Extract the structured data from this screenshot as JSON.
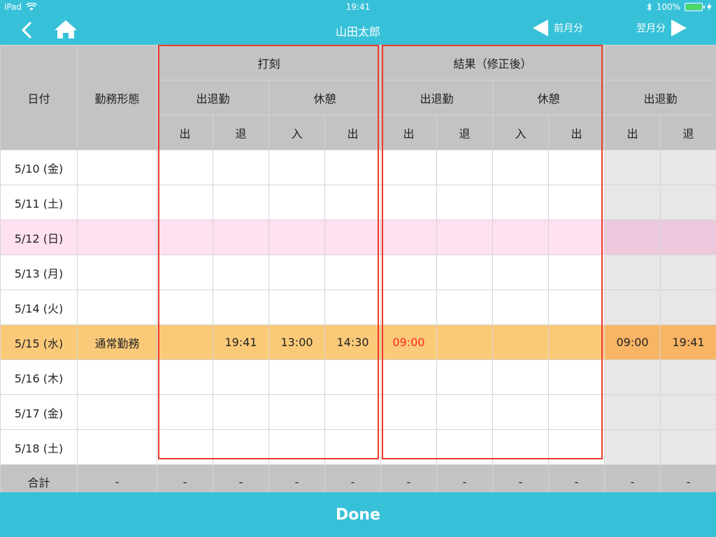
{
  "status": {
    "device": "iPad",
    "time": "19:41",
    "battery": "100%"
  },
  "nav": {
    "title": "山田太郎",
    "prev_label": "前月分",
    "next_label": "翌月分"
  },
  "headers": {
    "date": "日付",
    "worktype": "勤務形態",
    "group_punch": "打刻",
    "group_result": "結果（修正後）",
    "attendance": "出退勤",
    "break": "休憩",
    "in": "出",
    "out": "退",
    "break_in": "入",
    "break_out": "出"
  },
  "rows": [
    {
      "date": "5/10 (金)",
      "type": "",
      "p_in": "",
      "p_out": "",
      "p_b_in": "",
      "p_b_out": "",
      "r_in": "",
      "r_out": "",
      "r_b_in": "",
      "r_b_out": "",
      "e_in": "",
      "e_out": ""
    },
    {
      "date": "5/11 (土)",
      "type": "",
      "p_in": "",
      "p_out": "",
      "p_b_in": "",
      "p_b_out": "",
      "r_in": "",
      "r_out": "",
      "r_b_in": "",
      "r_b_out": "",
      "e_in": "",
      "e_out": ""
    },
    {
      "date": "5/12 (日)",
      "type": "",
      "p_in": "",
      "p_out": "",
      "p_b_in": "",
      "p_b_out": "",
      "r_in": "",
      "r_out": "",
      "r_b_in": "",
      "r_b_out": "",
      "e_in": "",
      "e_out": ""
    },
    {
      "date": "5/13 (月)",
      "type": "",
      "p_in": "",
      "p_out": "",
      "p_b_in": "",
      "p_b_out": "",
      "r_in": "",
      "r_out": "",
      "r_b_in": "",
      "r_b_out": "",
      "e_in": "",
      "e_out": ""
    },
    {
      "date": "5/14 (火)",
      "type": "",
      "p_in": "",
      "p_out": "",
      "p_b_in": "",
      "p_b_out": "",
      "r_in": "",
      "r_out": "",
      "r_b_in": "",
      "r_b_out": "",
      "e_in": "",
      "e_out": ""
    },
    {
      "date": "5/15 (水)",
      "type": "通常勤務",
      "p_in": "",
      "p_out": "19:41",
      "p_b_in": "13:00",
      "p_b_out": "14:30",
      "r_in": "09:00",
      "r_out": "",
      "r_b_in": "",
      "r_b_out": "",
      "e_in": "09:00",
      "e_out": "19:41"
    },
    {
      "date": "5/16 (木)",
      "type": "",
      "p_in": "",
      "p_out": "",
      "p_b_in": "",
      "p_b_out": "",
      "r_in": "",
      "r_out": "",
      "r_b_in": "",
      "r_b_out": "",
      "e_in": "",
      "e_out": ""
    },
    {
      "date": "5/17 (金)",
      "type": "",
      "p_in": "",
      "p_out": "",
      "p_b_in": "",
      "p_b_out": "",
      "r_in": "",
      "r_out": "",
      "r_b_in": "",
      "r_b_out": "",
      "e_in": "",
      "e_out": ""
    },
    {
      "date": "5/18 (土)",
      "type": "",
      "p_in": "",
      "p_out": "",
      "p_b_in": "",
      "p_b_out": "",
      "r_in": "",
      "r_out": "",
      "r_b_in": "",
      "r_b_out": "",
      "e_in": "",
      "e_out": ""
    }
  ],
  "totals": {
    "label": "合計",
    "value": "-"
  },
  "footer": {
    "done_label": "Done"
  },
  "colors": {
    "accent": "#37c1d8",
    "header_gray": "#c3c3c3",
    "highlight_red": "#ee3a2c",
    "sunday_pink": "#ffe0f0",
    "today_orange": "#fbca79",
    "edited_red": "#ff2a1a"
  }
}
